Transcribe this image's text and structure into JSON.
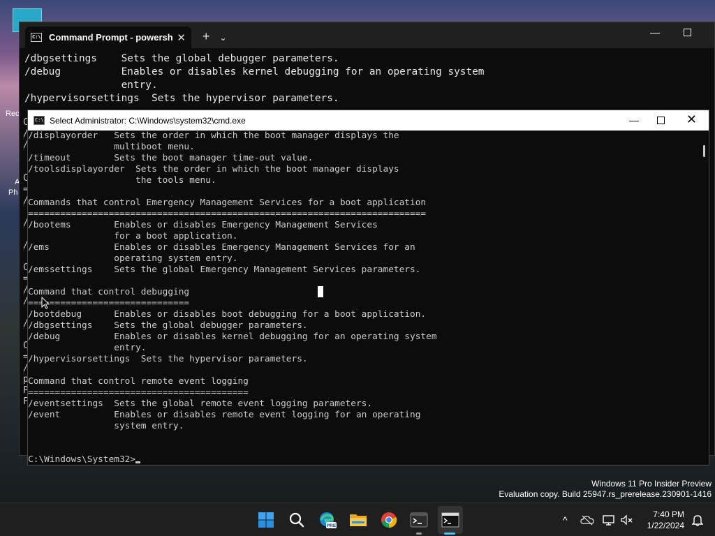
{
  "desktop": {
    "icon_labels": [
      "Rec",
      "A",
      "Ph"
    ]
  },
  "terminal": {
    "tab_title": "Command Prompt - powershe",
    "tab_close": "✕",
    "new_tab": "+",
    "dropdown": "⌄",
    "minimize": "—",
    "lines": [
      "/dbgsettings    Sets the global debugger parameters.",
      "/debug          Enables or disables kernel debugging for an operating system",
      "                entry.",
      "/hypervisorsettings  Sets the hypervisor parameters."
    ],
    "left_edge_chars": [
      "C",
      "/",
      "/",
      "",
      "",
      "C",
      "=",
      "/",
      "",
      "/",
      "",
      "/",
      "",
      "C",
      "=",
      "/",
      "/",
      "",
      "/",
      "",
      "C",
      "=",
      "/",
      "p",
      "P",
      "F"
    ]
  },
  "cmd": {
    "title": "Select Administrator: C:\\Windows\\system32\\cmd.exe",
    "icon_text": "C:\\",
    "minimize": "—",
    "close": "✕",
    "lines": [
      "/displayorder   Sets the order in which the boot manager displays the",
      "                multiboot menu.",
      "/timeout        Sets the boot manager time-out value.",
      "/toolsdisplayorder  Sets the order in which the boot manager displays",
      "                    the tools menu.",
      "",
      "Commands that control Emergency Management Services for a boot application",
      "==========================================================================",
      "/bootems        Enables or disables Emergency Management Services",
      "                for a boot application.",
      "/ems            Enables or disables Emergency Management Services for an",
      "                operating system entry.",
      "/emssettings    Sets the global Emergency Management Services parameters.",
      "",
      "Command that control debugging",
      "==============================",
      "/bootdebug      Enables or disables boot debugging for a boot application.",
      "/dbgsettings    Sets the global debugger parameters.",
      "/debug          Enables or disables kernel debugging for an operating system",
      "                entry.",
      "/hypervisorsettings  Sets the hypervisor parameters.",
      "",
      "Command that control remote event logging",
      "=========================================",
      "/eventsettings  Sets the global remote event logging parameters.",
      "/event          Enables or disables remote event logging for an operating",
      "                system entry.",
      "",
      ""
    ],
    "prompt": "C:\\Windows\\System32>"
  },
  "watermark": {
    "line1": "Windows 11 Pro Insider Preview",
    "line2": "Evaluation copy. Build 25947.rs_prerelease.230901-1416"
  },
  "taskbar": {
    "apps": [
      "start-icon",
      "search-icon",
      "edge-pre-icon",
      "file-explorer-icon",
      "chrome-icon",
      "terminal-icon",
      "cmd-icon"
    ],
    "edge_badge": "PRE",
    "clock_time": "7:40 PM",
    "clock_date": "1/22/2024",
    "chevron": "^"
  }
}
